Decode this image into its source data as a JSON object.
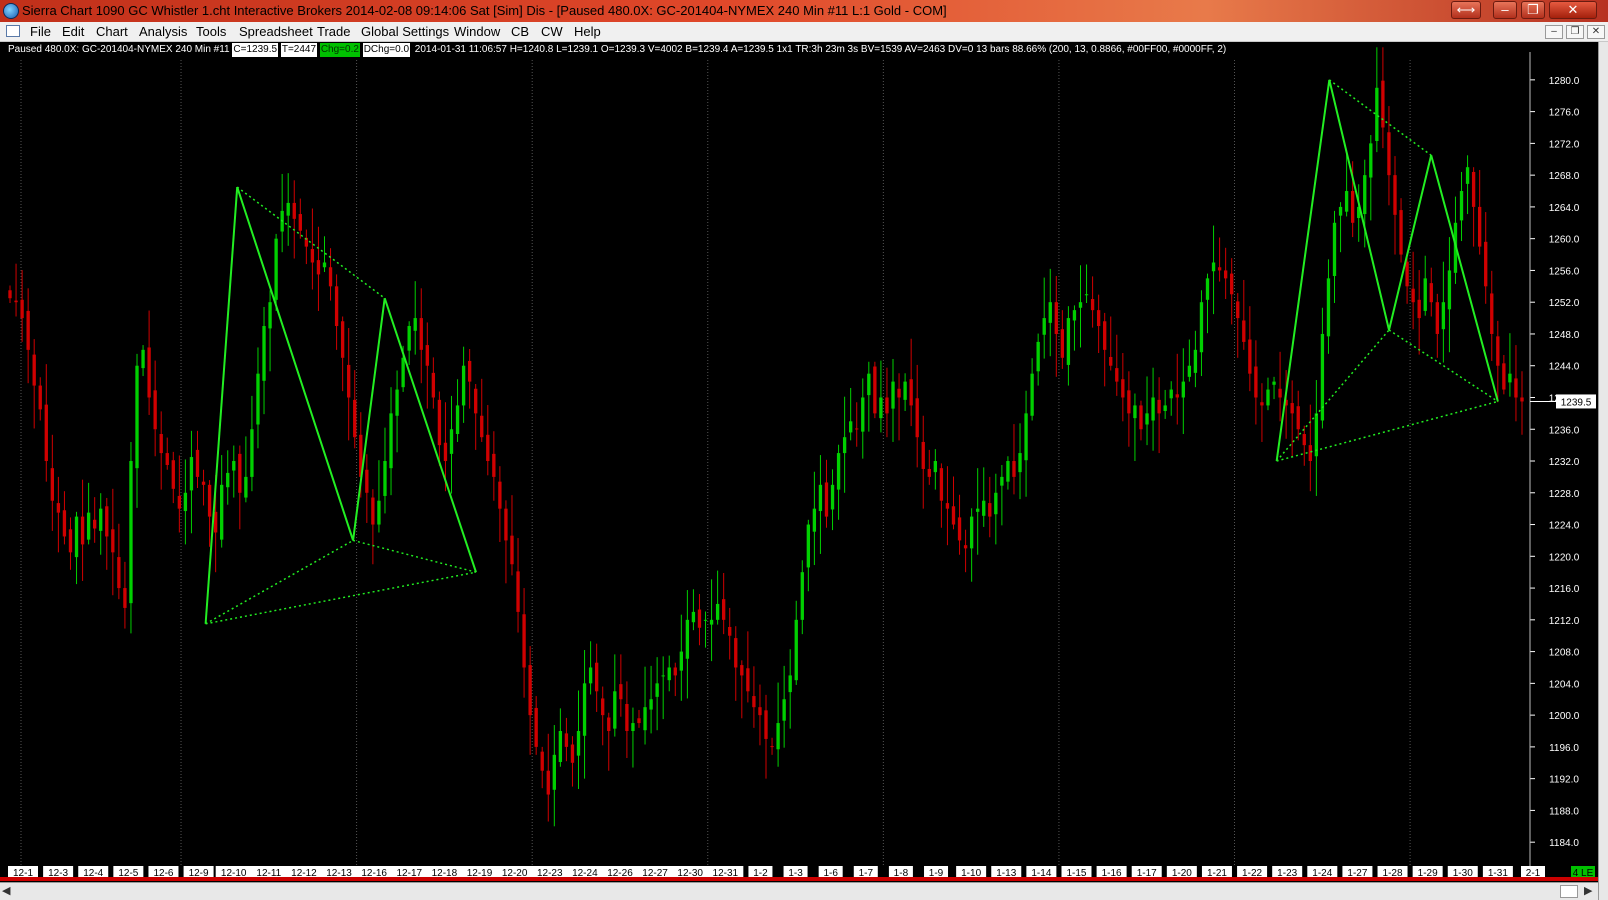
{
  "window": {
    "title": "Sierra Chart 1090 GC Whistler 1.cht  Interactive Brokers 2014-02-08  09:14:06 Sat [Sim]  Dis - [Paused 480.0X: GC-201404-NYMEX  240 Min   #11  L:1  Gold - COM]",
    "buttons": {
      "swap": "⟷",
      "minimize": "–",
      "maximize": "❐",
      "close": "✕"
    }
  },
  "menu": {
    "items": [
      "File",
      "Edit",
      "Chart",
      "Analysis",
      "Tools",
      "Spreadsheet",
      "Trade",
      "Global Settings",
      "Window",
      "CB",
      "CW",
      "Help"
    ],
    "mdi_buttons": {
      "minimize": "–",
      "restore": "❐",
      "close": "✕"
    }
  },
  "info_line": {
    "prefix": "Paused 480.0X: GC-201404-NYMEX  240 Min  #11",
    "close_box": "C=1239.5",
    "t_box": "T=2447",
    "chg_box": "Chg=0.2",
    "dchg_box": "DChg=0.0",
    "details": "2014-01-31 11:06:57 H=1240.8 L=1239.1 O=1239.3 V=4002 B=1239.4 A=1239.5 1x1 TR:3h 23m 3s BV=1539 AV=2463 DV=0  13 bars 88.66%  (200, 13, 0.8866, #00FF00, #0000FF, 2)"
  },
  "colors": {
    "up": "#00d000",
    "down": "#d00000",
    "pattern": "#22ee22",
    "axis_text": "#ffffff",
    "last_price_box": "#ffffff",
    "background": "#000000"
  },
  "last_price_label": "1239.5",
  "corner_label": "4 LE",
  "chart_data": {
    "type": "candlestick",
    "symbol": "GC-201404-NYMEX",
    "interval": "240 Min",
    "y_ticks": [
      1280.0,
      1276.0,
      1272.0,
      1268.0,
      1264.0,
      1260.0,
      1256.0,
      1252.0,
      1248.0,
      1244.0,
      1240.0,
      1236.0,
      1232.0,
      1228.0,
      1224.0,
      1220.0,
      1216.0,
      1212.0,
      1208.0,
      1204.0,
      1200.0,
      1196.0,
      1192.0,
      1188.0,
      1184.0
    ],
    "ylim": [
      1181.0,
      1282.5
    ],
    "date_labels": [
      "12-1",
      "12-3",
      "12-4",
      "12-5",
      "12-6",
      "12-9",
      "12-10",
      "12-11",
      "12-12",
      "12-13",
      "12-16",
      "12-17",
      "12-18",
      "12-19",
      "12-20",
      "12-23",
      "12-24",
      "12-26",
      "12-27",
      "12-30",
      "12-31",
      "1-2",
      "1-3",
      "1-6",
      "1-7",
      "1-8",
      "1-9",
      "1-10",
      "1-13",
      "1-14",
      "1-15",
      "1-16",
      "1-17",
      "1-20",
      "1-21",
      "1-22",
      "1-23",
      "1-24",
      "1-27",
      "1-28",
      "1-29",
      "1-30",
      "1-31",
      "2-1"
    ],
    "closes": [
      1252.5,
      1252.0,
      1250.0,
      1246.0,
      1241.5,
      1238.5,
      1232.0,
      1227.0,
      1225.5,
      1222.5,
      1220.5,
      1225.0,
      1221.5,
      1225.5,
      1223.5,
      1226.0,
      1222.5,
      1220.5,
      1216.0,
      1213.5,
      1232.0,
      1244.0,
      1246.0,
      1240.0,
      1236.0,
      1233.0,
      1231.5,
      1228.5,
      1226.0,
      1228.0,
      1232.5,
      1230.0,
      1229.0,
      1225.0,
      1223.0,
      1229.0,
      1230.5,
      1232.0,
      1228.0,
      1230.0,
      1236.0,
      1243.0,
      1249.0,
      1252.0,
      1260.0,
      1263.5,
      1264.5,
      1262.5,
      1261.0,
      1259.0,
      1257.0,
      1255.5,
      1257.0,
      1254.0,
      1249.0,
      1245.0,
      1240.0,
      1235.0,
      1230.0,
      1228.0,
      1224.0,
      1227.0,
      1232.0,
      1238.0,
      1241.0,
      1245.0,
      1249.0,
      1250.0,
      1246.0,
      1244.0,
      1240.0,
      1234.0,
      1232.0,
      1236.0,
      1239.0,
      1244.0,
      1242.0,
      1238.0,
      1235.0,
      1232.0,
      1230.0,
      1226.0,
      1222.0,
      1219.0,
      1213.0,
      1206.0,
      1200.0,
      1196.0,
      1193.0,
      1190.0,
      1195.0,
      1198.0,
      1196.0,
      1194.0,
      1198.0,
      1204.0,
      1206.0,
      1203.0,
      1200.0,
      1198.0,
      1203.0,
      1202.0,
      1198.0,
      1199.0,
      1199.0,
      1201.0,
      1202.0,
      1204.0,
      1205.0,
      1206.0,
      1205.0,
      1208.0,
      1212.0,
      1213.0,
      1211.0,
      1212.0,
      1212.0,
      1214.0,
      1212.0,
      1210.0,
      1206.0,
      1205.0,
      1203.0,
      1201.0,
      1200.0,
      1197.0,
      1196.0,
      1199.0,
      1202.0,
      1205.0,
      1212.0,
      1218.0,
      1224.0,
      1226.0,
      1229.0,
      1225.0,
      1229.0,
      1233.0,
      1235.0,
      1237.0,
      1236.0,
      1240.0,
      1243.0,
      1238.0,
      1240.0,
      1238.0,
      1242.0,
      1240.0,
      1242.0,
      1239.0,
      1235.0,
      1231.0,
      1230.0,
      1232.0,
      1227.0,
      1226.0,
      1224.0,
      1222.0,
      1221.0,
      1225.0,
      1226.0,
      1227.0,
      1225.0,
      1228.0,
      1230.0,
      1232.0,
      1230.0,
      1233.0,
      1238.0,
      1243.0,
      1247.0,
      1250.0,
      1252.0,
      1248.0,
      1245.0,
      1250.0,
      1251.0,
      1252.0,
      1253.0,
      1251.0,
      1249.0,
      1246.0,
      1244.0,
      1242.0,
      1240.0,
      1238.0,
      1239.0,
      1236.0,
      1238.0,
      1240.0,
      1238.0,
      1239.0,
      1241.0,
      1240.0,
      1242.0,
      1244.0,
      1246.0,
      1252.0,
      1255.0,
      1257.0,
      1256.0,
      1255.0,
      1253.0,
      1250.0,
      1247.0,
      1243.0,
      1240.0,
      1239.0,
      1241.0,
      1242.0,
      1240.0,
      1239.0,
      1238.0,
      1236.0,
      1234.0,
      1232.0,
      1238.0,
      1248.0,
      1255.0,
      1262.0,
      1264.0,
      1266.0,
      1262.0,
      1264.0,
      1268.0,
      1272.0,
      1279.0,
      1274.0,
      1268.0,
      1263.0,
      1258.0,
      1254.0,
      1252.0,
      1250.0,
      1255.0,
      1252.0,
      1248.0,
      1252.0,
      1256.0,
      1262.0,
      1266.0,
      1269.0,
      1264.0,
      1259.0,
      1254.0,
      1248.0,
      1244.0,
      1241.0,
      1243.0,
      1240.0,
      1239.5
    ]
  },
  "pattern_points": [
    {
      "label": "left-pattern-X",
      "date_index": 5.2,
      "price": 1211.5
    },
    {
      "label": "left-pattern-A",
      "date_index": 6.1,
      "price": 1266.5
    },
    {
      "label": "left-pattern-B",
      "date_index": 9.4,
      "price": 1222.0
    },
    {
      "label": "left-pattern-C",
      "date_index": 10.3,
      "price": 1252.5
    },
    {
      "label": "left-pattern-D",
      "date_index": 12.9,
      "price": 1218.0
    },
    {
      "label": "right-pattern-X",
      "date_index": 35.7,
      "price": 1232.0
    },
    {
      "label": "right-pattern-A",
      "date_index": 37.2,
      "price": 1280.0
    },
    {
      "label": "right-pattern-B",
      "date_index": 38.9,
      "price": 1248.5
    },
    {
      "label": "right-pattern-C",
      "date_index": 40.1,
      "price": 1270.5
    },
    {
      "label": "right-pattern-D",
      "date_index": 42.0,
      "price": 1239.5
    }
  ]
}
